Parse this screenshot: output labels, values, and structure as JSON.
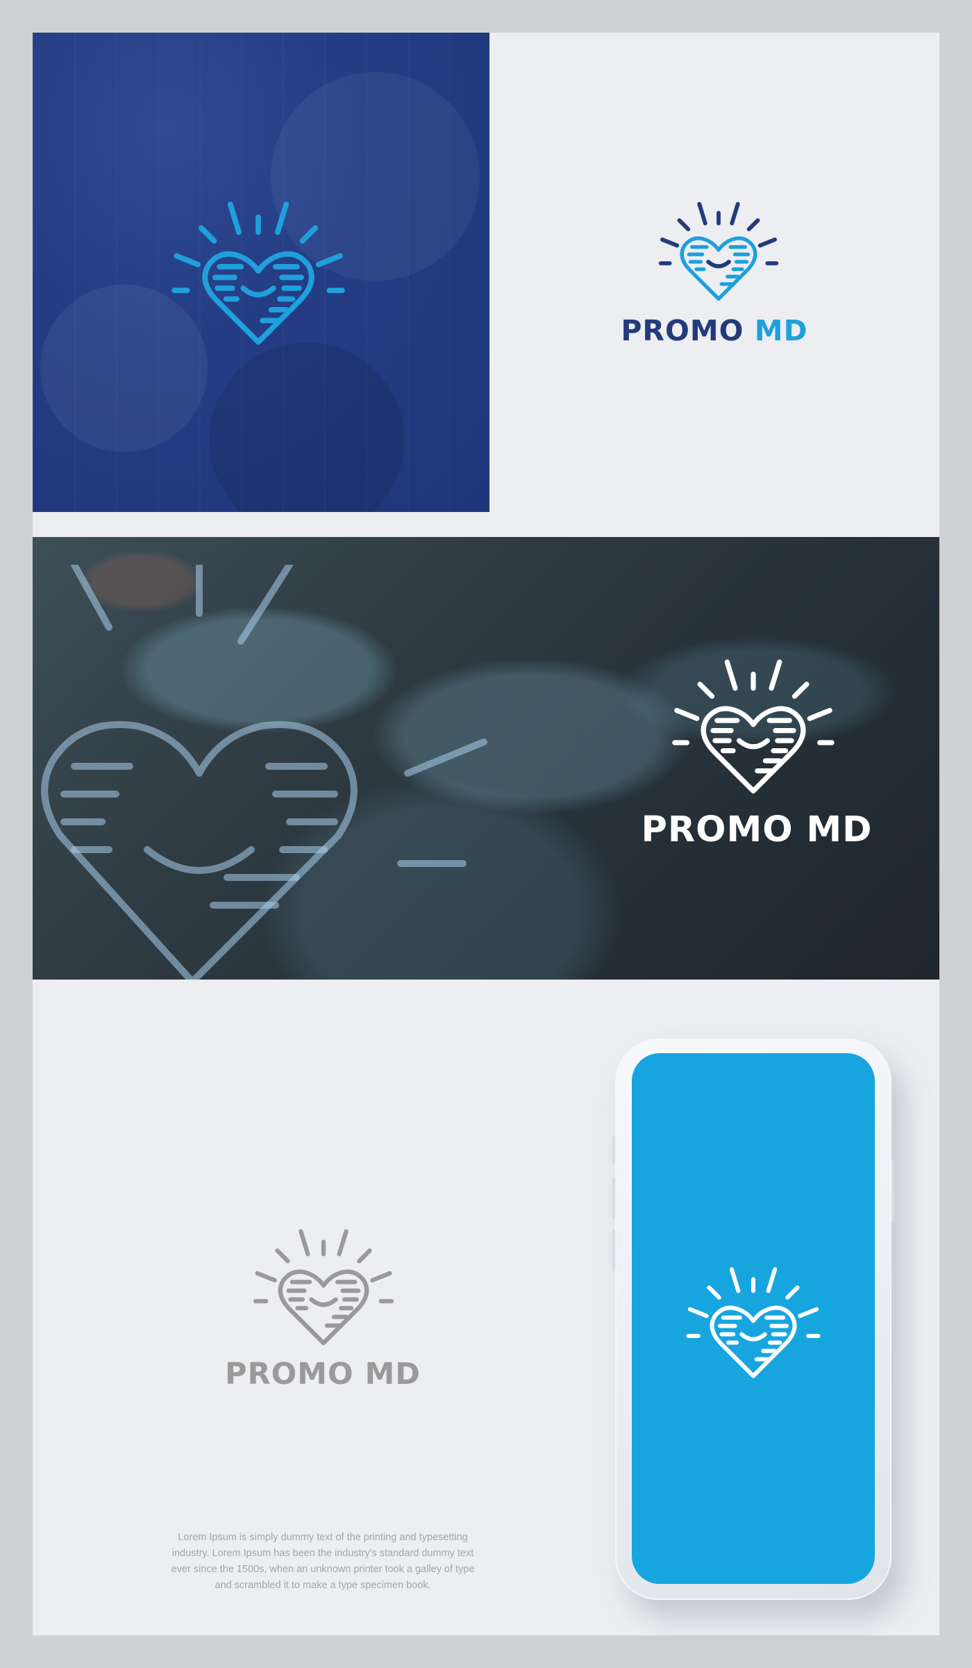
{
  "brand": {
    "name_part1": "PROMO",
    "name_part2": "MD",
    "full_name": "PROMO MD"
  },
  "colors": {
    "navy": "#233b7c",
    "navy_panel": "#243d85",
    "light_blue": "#1fa0dc",
    "phone_screen_blue": "#17a5e0",
    "gray_logo": "#9a9a9a",
    "background": "#eceef1"
  },
  "icons": {
    "logo_mark": "smiling-heart-with-rays-icon"
  },
  "body_copy": {
    "lines": [
      "Lorem Ipsum is simply dummy text of the printing and typesetting",
      "industry. Lorem Ipsum has been the industry's standard dummy text",
      "ever since the 1500s, when an unknown printer took a galley of type",
      "and scrambled it to make a type specimen book."
    ]
  }
}
